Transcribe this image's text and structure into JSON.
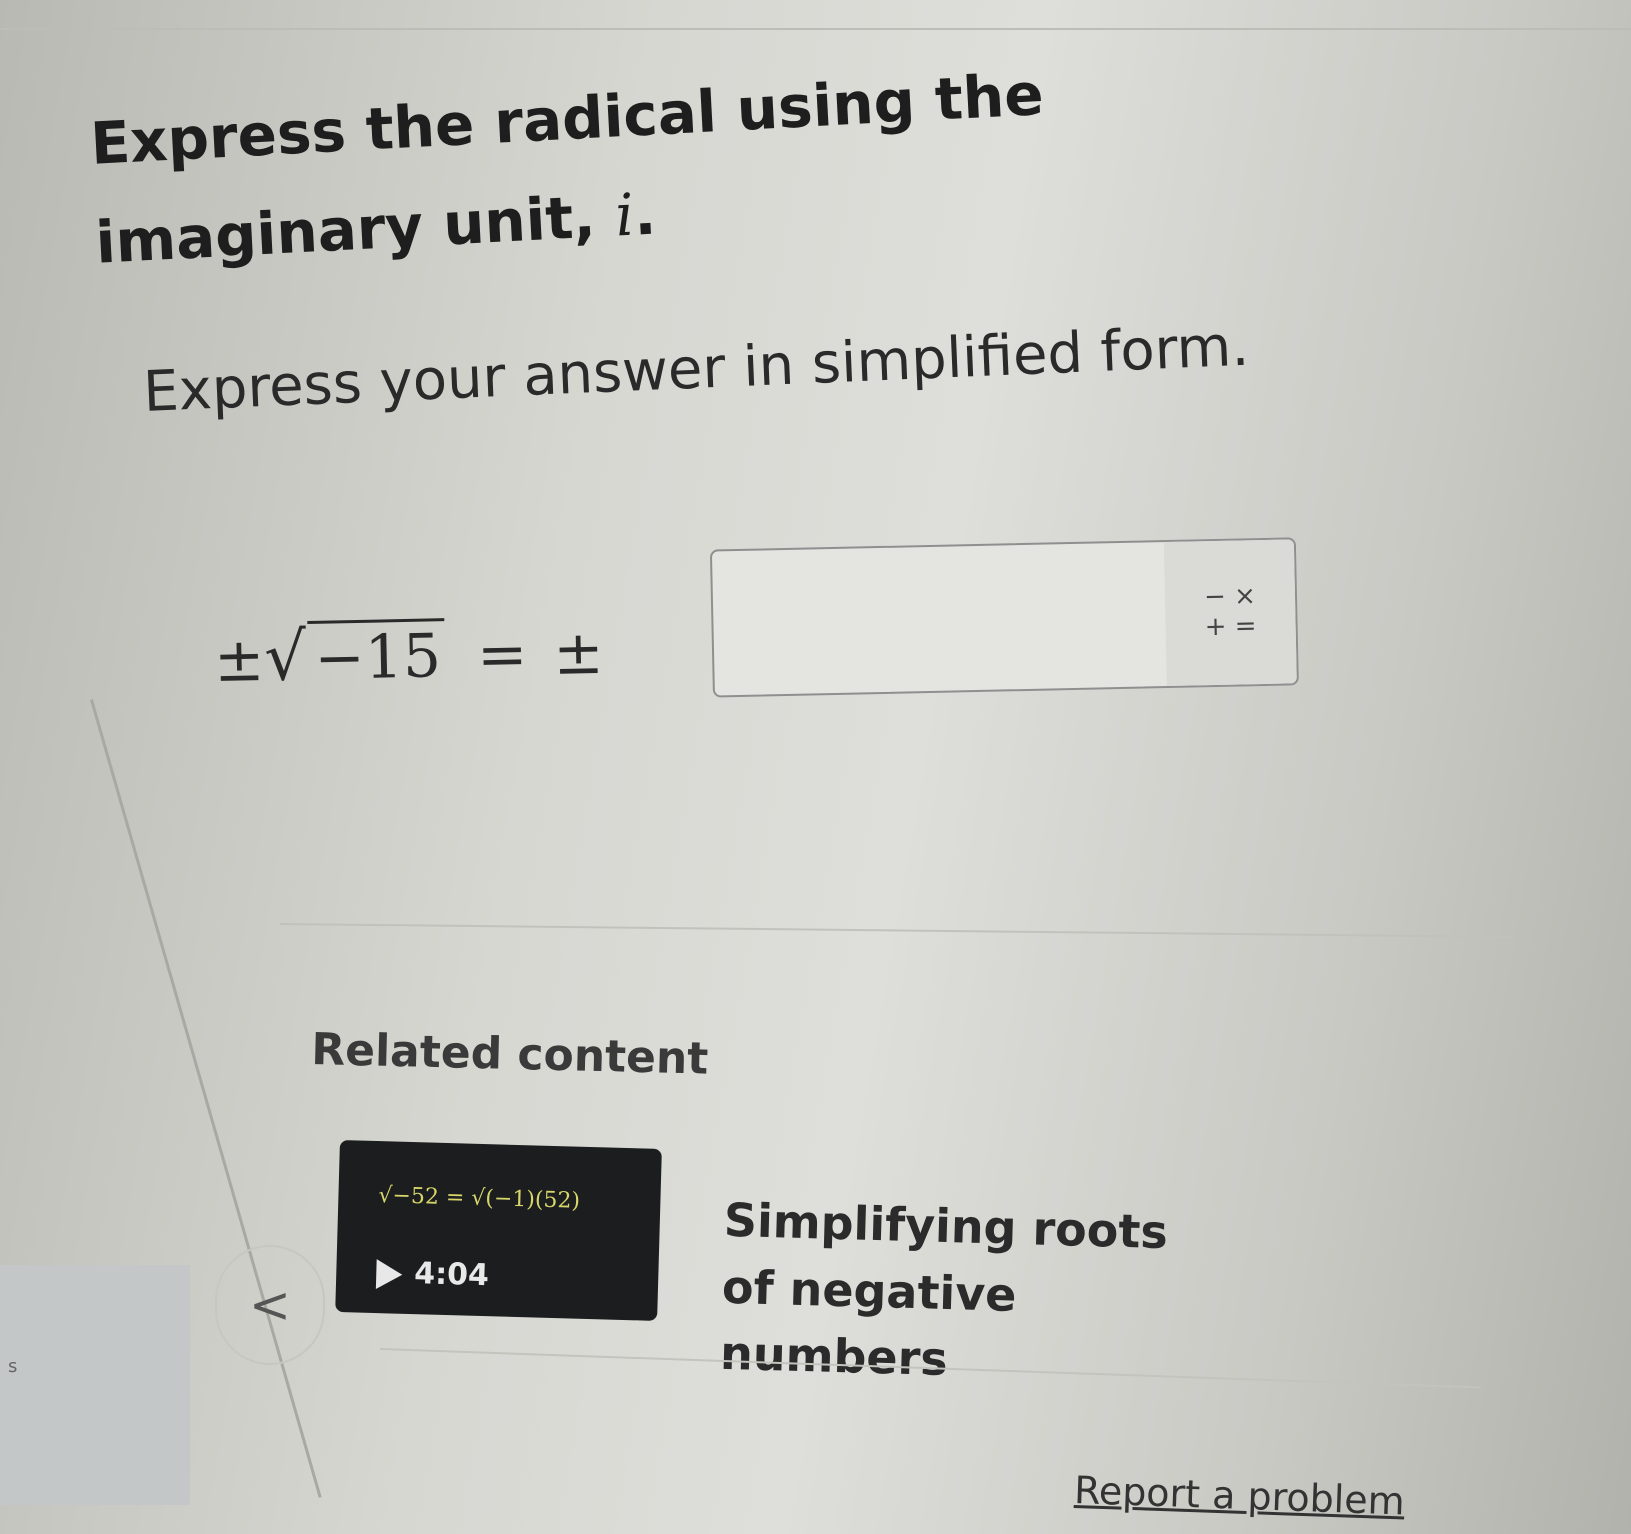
{
  "question": {
    "line1": "Express the radical using the",
    "line2_text": "imaginary unit, ",
    "line2_var": "i",
    "line2_end": ".",
    "instruction": "Express your answer in simplified form."
  },
  "equation": {
    "plus_minus_left": "±",
    "radical_sign": "√",
    "radicand": "−15",
    "equals": "=",
    "plus_minus_right": "±"
  },
  "answer": {
    "value": "",
    "keypad_top": "− ×",
    "keypad_bottom": "+ ="
  },
  "related": {
    "heading": "Related content",
    "video": {
      "thumb_formula": "√−52 = √(−1)(52)",
      "duration": "4:04",
      "title": "Simplifying roots of negative numbers"
    }
  },
  "nav": {
    "prev_arrow": "<"
  },
  "stray_mark": "s",
  "footer": {
    "report_link": "Report a problem"
  }
}
